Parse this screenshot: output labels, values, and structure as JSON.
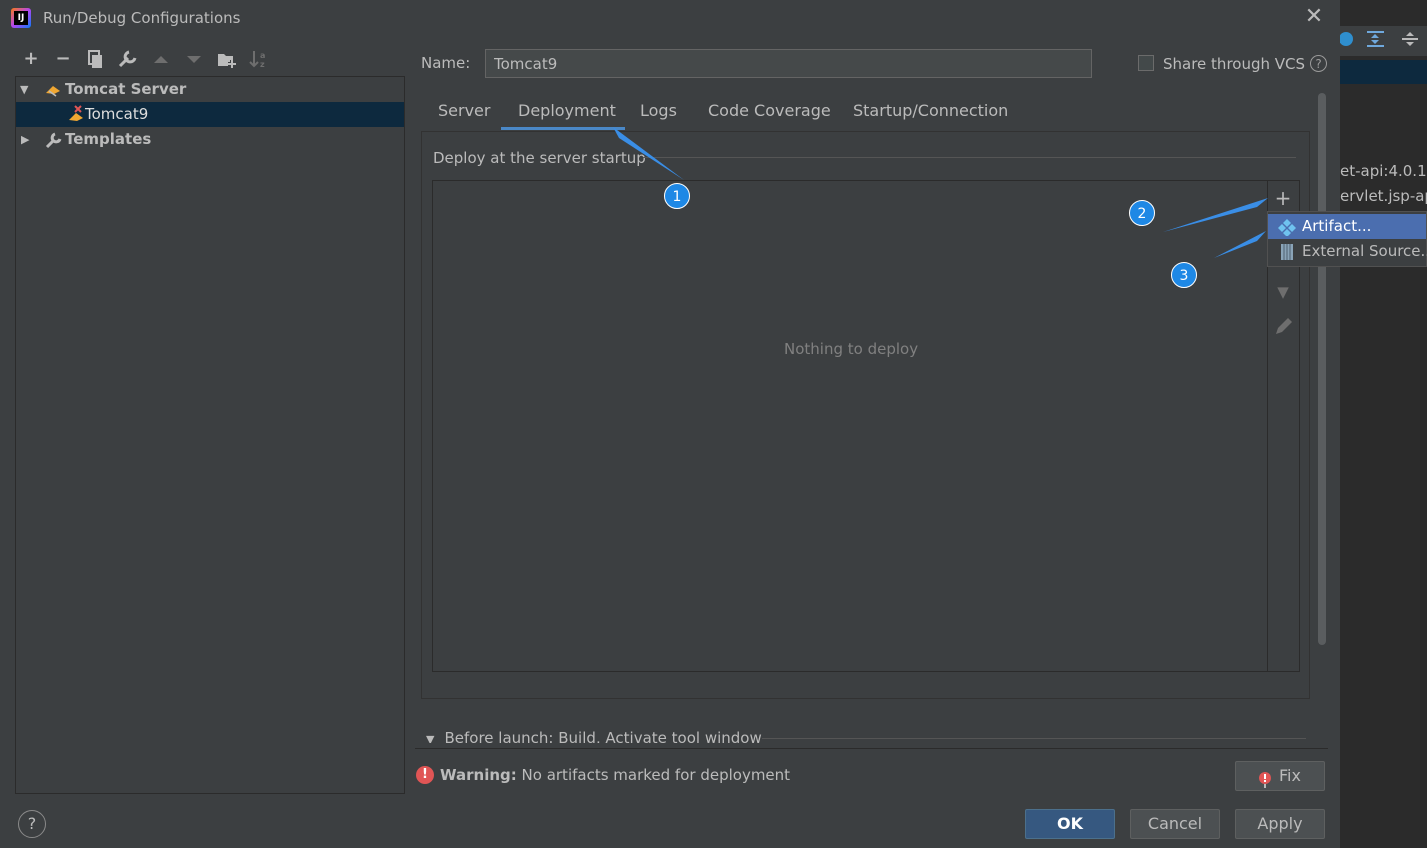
{
  "window": {
    "title": "Run/Debug Configurations",
    "close_glyph": "✕"
  },
  "background": {
    "lines": [
      "et-api:4.0.1",
      "ervlet.jsp-ap"
    ]
  },
  "toolbar": {
    "icons": [
      "add-icon",
      "remove-icon",
      "copy-icon",
      "wrench-icon",
      "move-up-icon",
      "move-down-icon",
      "folder-add-icon",
      "sort-icon"
    ]
  },
  "tree": {
    "items": [
      {
        "label": "Tomcat Server",
        "expanded": true
      },
      {
        "label": "Tomcat9",
        "selected": true
      },
      {
        "label": "Templates",
        "expanded": false
      }
    ]
  },
  "form": {
    "name_label": "Name:",
    "name_value": "Tomcat9",
    "share_vcs_label": "Share through VCS",
    "share_vcs_checked": false
  },
  "tabs": [
    {
      "label": "Server"
    },
    {
      "label": "Deployment",
      "active": true
    },
    {
      "label": "Logs"
    },
    {
      "label": "Code Coverage"
    },
    {
      "label": "Startup/Connection"
    }
  ],
  "deployment": {
    "section_label": "Deploy at the server startup",
    "empty_text": "Nothing to deploy"
  },
  "popup": {
    "items": [
      {
        "label": "Artifact...",
        "selected": true
      },
      {
        "label": "External Source..."
      }
    ]
  },
  "annotations": [
    "1",
    "2",
    "3"
  ],
  "before_launch": {
    "label": "Before launch: Build, Activate tool window"
  },
  "warning": {
    "bold": "Warning:",
    "text": " No artifacts marked for deployment"
  },
  "buttons": {
    "fix": "Fix",
    "ok": "OK",
    "cancel": "Cancel",
    "apply": "Apply",
    "help": "?"
  },
  "colors": {
    "accent": "#4a88c7",
    "selection": "#0d293e",
    "menu_selection": "#4b6eaf",
    "annotation": "#1e88e5"
  }
}
